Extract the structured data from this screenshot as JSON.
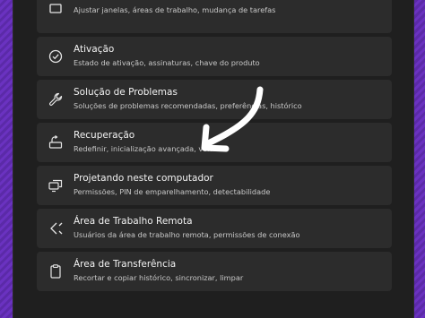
{
  "items": [
    {
      "title": "",
      "subtitle": "Ajustar janelas, áreas de trabalho, mudança de tarefas",
      "icon": "multitasking-icon"
    },
    {
      "title": "Ativação",
      "subtitle": "Estado de ativação, assinaturas, chave do produto",
      "icon": "check-circle-icon"
    },
    {
      "title": "Solução de Problemas",
      "subtitle": "Soluções de problemas recomendadas, preferências, histórico",
      "icon": "wrench-icon"
    },
    {
      "title": "Recuperação",
      "subtitle": "Redefinir, inicialização avançada, voltar",
      "icon": "recovery-icon"
    },
    {
      "title": "Projetando neste computador",
      "subtitle": "Permissões, PIN de emparelhamento, detectabilidade",
      "icon": "projection-icon"
    },
    {
      "title": "Área de Trabalho Remota",
      "subtitle": "Usuários da área de trabalho remota, permissões de conexão",
      "icon": "remote-desktop-icon"
    },
    {
      "title": "Área de Transferência",
      "subtitle": "Recortar e copiar histórico, sincronizar, limpar",
      "icon": "clipboard-icon"
    }
  ],
  "colors": {
    "background": "#5a2ea0",
    "panel": "#1f1f1f",
    "card": "#2c2c2c",
    "annotation": "#ffffff"
  }
}
